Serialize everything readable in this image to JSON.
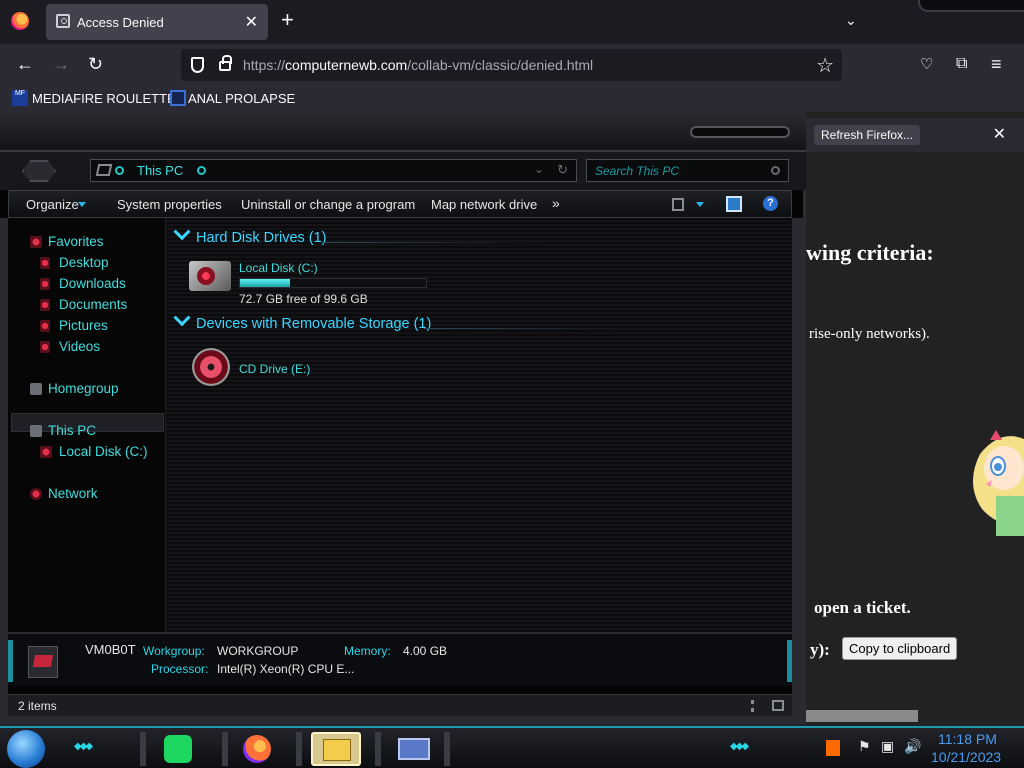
{
  "browser": {
    "tab": {
      "title": "Access Denied",
      "close": "✕"
    },
    "new_tab": "+",
    "tab_list": "⌄",
    "nav": {
      "back": "←",
      "forward": "→",
      "reload": "↻"
    },
    "url": {
      "host": "computernewb.com",
      "prefix": "https://",
      "path": "/collab-vm/classic/denied.html"
    },
    "bookmarks": [
      {
        "label": "MEDIAFIRE ROULETTER",
        "icon": "mediafire-icon",
        "icon_text": "MF"
      },
      {
        "label": "ANAL PROLAPSE",
        "icon": "bookmark-icon"
      }
    ],
    "notification": {
      "button": "Refresh Firefox...",
      "close": "✕"
    }
  },
  "page": {
    "criteria_text": "wing criteria:",
    "networks_text": "rise-only networks).",
    "ticket_text": "open a ticket.",
    "copy_label": "y):",
    "copy_button": "Copy to clipboard"
  },
  "explorer": {
    "address": "This PC",
    "search_placeholder": "Search This PC",
    "toolbar": {
      "organize": "Organize",
      "system_properties": "System properties",
      "uninstall": "Uninstall or change a program",
      "map_drive": "Map network drive",
      "more": "»",
      "help": "?"
    },
    "nav": {
      "favorites": "Favorites",
      "favorites_items": [
        "Desktop",
        "Downloads",
        "Documents",
        "Pictures",
        "Videos"
      ],
      "homegroup": "Homegroup",
      "this_pc": "This PC",
      "local_disk": "Local Disk (C:)",
      "network": "Network"
    },
    "groups": {
      "hdd": "Hard Disk Drives (1)",
      "removable": "Devices with Removable Storage (1)"
    },
    "drives": {
      "c_name": "Local Disk (C:)",
      "c_free": "72.7 GB free of 99.6 GB",
      "c_used_fraction": 0.27,
      "cd_name": "CD Drive (E:)"
    },
    "details": {
      "pc_name": "VM0B0T",
      "workgroup_label": "Workgroup:",
      "workgroup": "WORKGROUP",
      "memory_label": "Memory:",
      "memory": "4.00 GB",
      "processor_label": "Processor:",
      "processor": "Intel(R) Xeon(R) CPU E..."
    },
    "status": {
      "items": "2 items"
    }
  },
  "taskbar": {
    "clock_time": "11:18 PM",
    "clock_date": "10/21/2023",
    "tray_icons": [
      "flag-icon",
      "network-icon",
      "volume-icon"
    ]
  }
}
